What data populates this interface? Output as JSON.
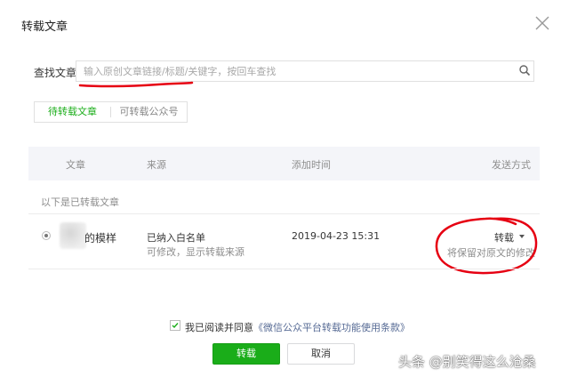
{
  "dialog": {
    "title": "转载文章"
  },
  "search": {
    "label": "查找文章",
    "value": "",
    "placeholder": "输入原创文章链接/标题/关键字，按回车查找"
  },
  "tabs": [
    {
      "label": "待转载文章",
      "active": true
    },
    {
      "label": "可转载公众号",
      "active": false
    }
  ],
  "table": {
    "headers": {
      "article": "文章",
      "source": "来源",
      "added_time": "添加时间",
      "send_method": "发送方式"
    },
    "section_label": "以下是已转载文章",
    "rows": [
      {
        "article_title": "的模样",
        "source_main": "已纳入白名单",
        "source_sub": "可修改，显示转载来源",
        "added_time": "2019-04-23 15:31",
        "send_method": "转载",
        "send_note": "将保留对原文的修改"
      }
    ]
  },
  "agreement": {
    "prefix": "我已阅读并同意",
    "link": "《微信公众平台转载功能使用条款》",
    "checked": true
  },
  "buttons": {
    "confirm": "转载",
    "cancel": "取消"
  },
  "watermark": "头条 @别笑得这么沧桑",
  "colors": {
    "accent": "#1aad19",
    "link": "#576b95",
    "annotation": "#e60012"
  }
}
